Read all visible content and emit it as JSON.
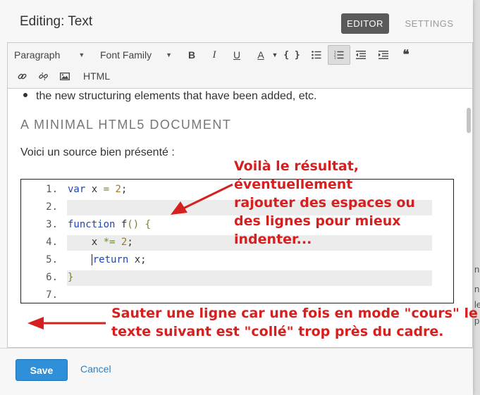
{
  "header": {
    "title": "Editing: Text",
    "tab_editor": "EDITOR",
    "tab_settings": "SETTINGS"
  },
  "toolbar": {
    "format_select": "Paragraph",
    "font_select": "Font Family",
    "bold": "B",
    "italic": "I",
    "underline": "U",
    "text_color": "A",
    "code": "{ }",
    "quote": "❝",
    "html": "HTML"
  },
  "content": {
    "bullet": "the new structuring elements that have been added, etc.",
    "heading": "A MINIMAL HTML5 DOCUMENT",
    "paragraph": "Voici un source bien présenté :",
    "line_numbers": [
      "1.",
      "2.",
      "3.",
      "4.",
      "5.",
      "6.",
      "7."
    ]
  },
  "annotations": {
    "top": [
      "Voilà le résultat, éventuellement",
      "rajouter des espaces ou",
      "des lignes pour mieux indenter..."
    ],
    "bottom": [
      "Sauter une ligne car une fois en mode \"cours\" le",
      "texte suivant est \"collé\" trop près du cadre."
    ],
    "color": "#d61f1f"
  },
  "footer": {
    "save": "Save",
    "cancel": "Cancel"
  },
  "side": {
    "items": [
      "n",
      "n",
      "le",
      "pl"
    ]
  },
  "colors": {
    "accent": "#2f8fd8",
    "active_tab": "#5a5a5a"
  }
}
